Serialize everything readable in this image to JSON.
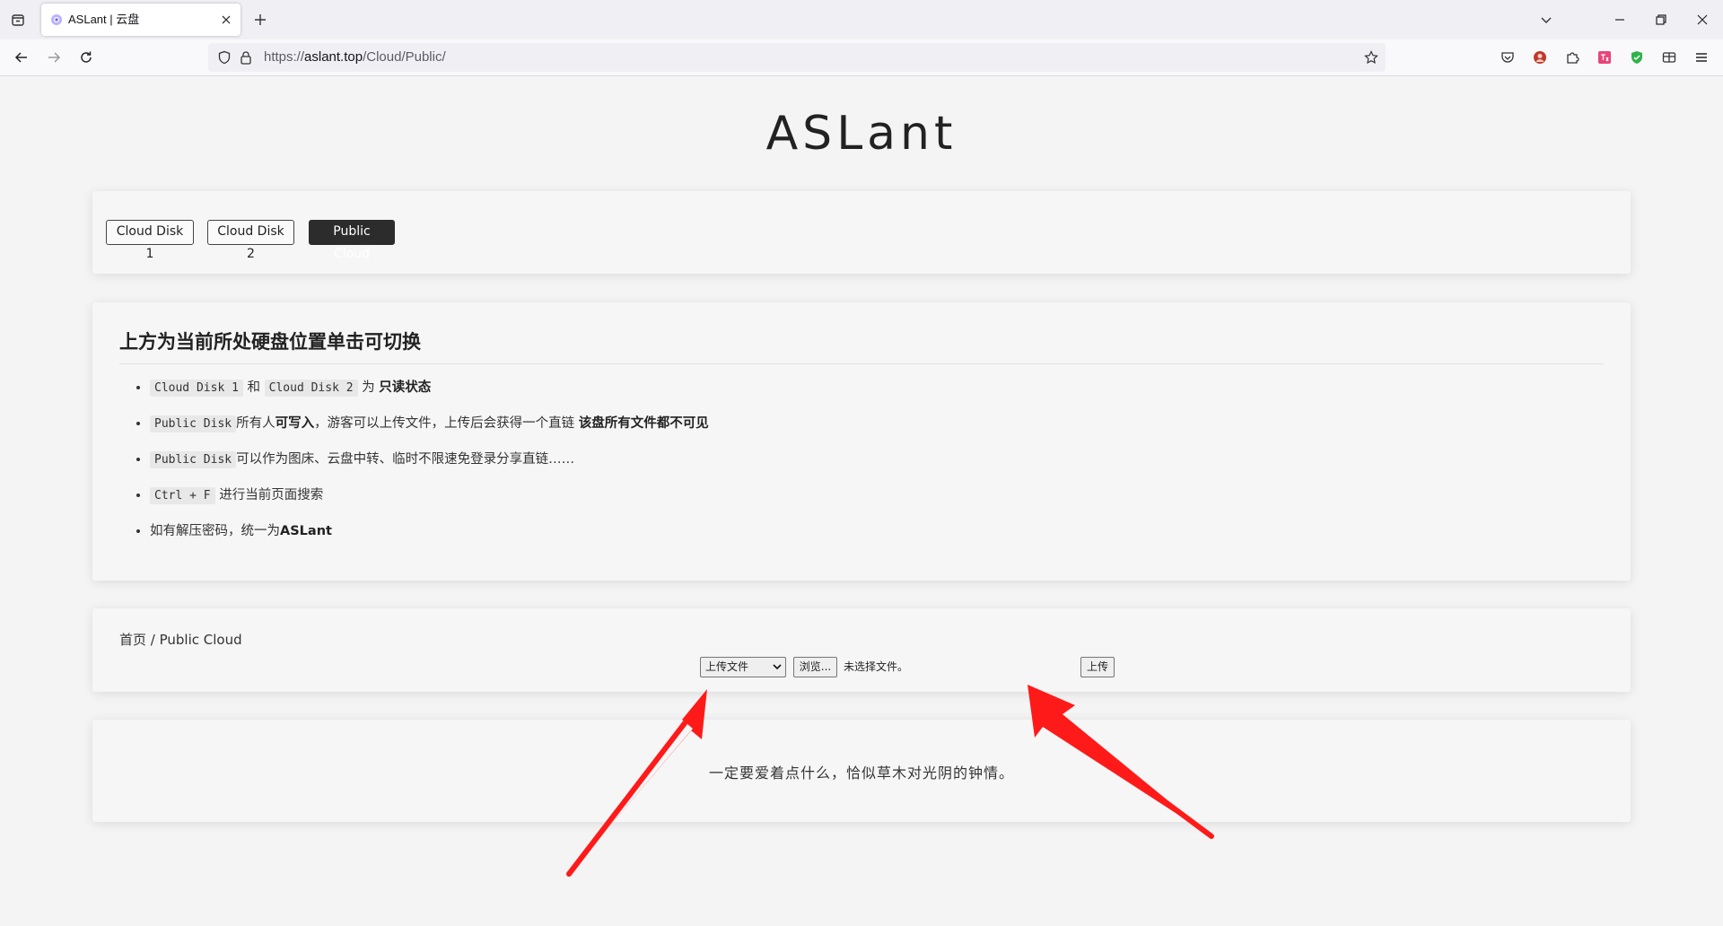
{
  "browser": {
    "tab_title": "ASLant | 云盘",
    "url_prefix": "https://",
    "url_host": "aslant.top",
    "url_path": "/Cloud/Public/"
  },
  "page": {
    "site_title": "ASLant",
    "disks": [
      {
        "label": "Cloud Disk 1",
        "active": false
      },
      {
        "label": "Cloud Disk 2",
        "active": false
      },
      {
        "label": "Public Cloud",
        "active": true
      }
    ],
    "info": {
      "heading": "上方为当前所处硬盘位置单击可切换",
      "items": [
        {
          "code1": "Cloud Disk 1",
          "t1": " 和 ",
          "code2": "Cloud Disk 2",
          "t2": " 为 ",
          "bold": "只读状态"
        },
        {
          "code": "Public Disk",
          "t1": "所有人",
          "bold1": "可写入",
          "t2": "，游客可以上传文件，上传后会获得一个直链 ",
          "bold2": "该盘所有文件都不可见"
        },
        {
          "code": "Public Disk",
          "t1": "可以作为图床、云盘中转、临时不限速免登录分享直链……"
        },
        {
          "code": "Ctrl + F",
          "t1": " 进行当前页面搜索"
        },
        {
          "t1": "如有解压密码，统一为",
          "bold": "ASLant"
        }
      ]
    },
    "breadcrumb": "首页 / Public Cloud",
    "upload": {
      "select_value": "上传文件",
      "browse_label": "浏览...",
      "no_file_text": "未选择文件。",
      "submit_label": "上传"
    },
    "quote": "一定要爱着点什么，恰似草木对光阴的钟情。"
  },
  "colors": {
    "accent_dark": "#2c2c2c",
    "arrow_red": "#ff1a1a",
    "page_bg": "#f4f4f4"
  }
}
